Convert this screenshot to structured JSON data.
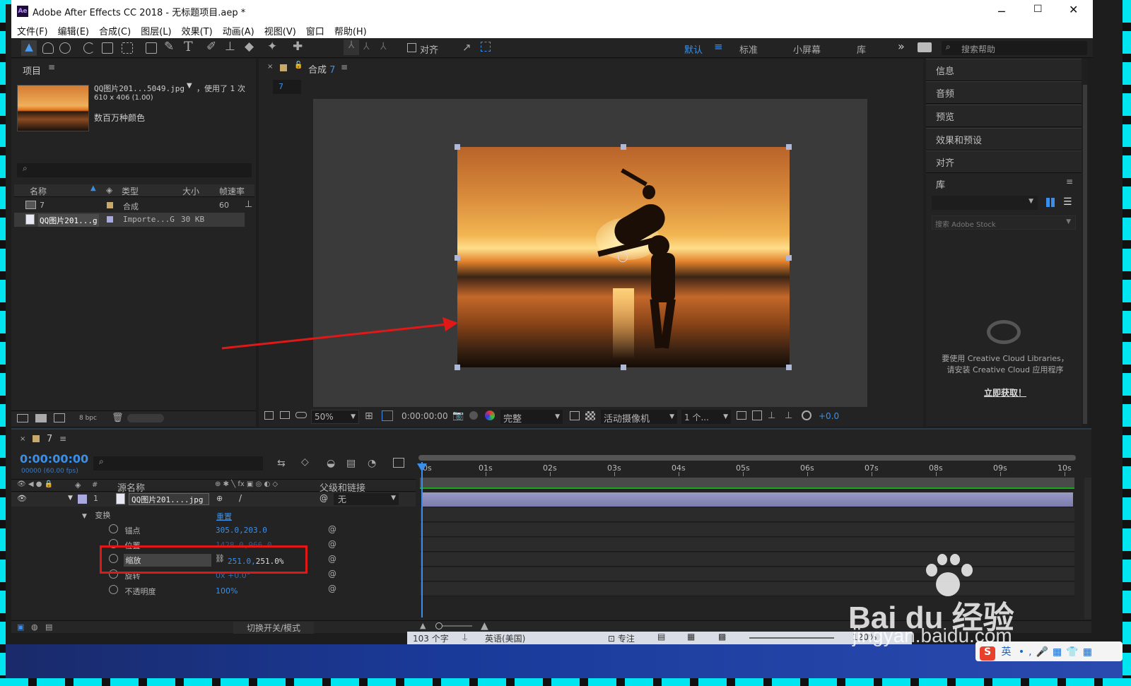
{
  "window": {
    "title": "Adobe After Effects CC 2018 - 无标题项目.aep *",
    "app_icon": "Ae"
  },
  "menu": [
    "文件(F)",
    "编辑(E)",
    "合成(C)",
    "图层(L)",
    "效果(T)",
    "动画(A)",
    "视图(V)",
    "窗口",
    "帮助(H)"
  ],
  "toolbar": {
    "align_label": "对齐",
    "workspaces": [
      "默认",
      "标准",
      "小屏幕",
      "库"
    ],
    "search_placeholder": "搜索帮助"
  },
  "project": {
    "title": "项目",
    "thumb_name": "QQ图片201...5049.jpg",
    "thumb_used": "，使用了 1 次",
    "thumb_dims": "610 x 406 (1.00)",
    "thumb_colors": "数百万种颜色",
    "columns": [
      "名称",
      "类型",
      "大小",
      "帧速率"
    ],
    "rows": [
      {
        "name": "7",
        "type": "合成",
        "size": "",
        "fps": "60"
      },
      {
        "name": "QQ图片201...g",
        "type": "Importe...G",
        "size": "30 KB",
        "fps": ""
      }
    ],
    "bpc": "8 bpc"
  },
  "comp": {
    "tab": "合成",
    "tab_num": "7",
    "flow": "7",
    "zoom": "50%",
    "timecode": "0:00:00:00",
    "resolution": "完整",
    "camera": "活动摄像机",
    "views": "1 个...",
    "exposure": "+0.0"
  },
  "right_panel": {
    "items": [
      "信息",
      "音频",
      "预览",
      "效果和预设",
      "对齐"
    ],
    "library": "库",
    "stock_placeholder": "搜索 Adobe Stock",
    "cc_msg1": "要使用 Creative Cloud Libraries，",
    "cc_msg2": "请安装 Creative Cloud 应用程序",
    "cc_link": "立即获取！"
  },
  "timeline": {
    "tab": "7",
    "timecode": "0:00:00:00",
    "fps_note": "00000 (60.00 fps)",
    "col_source": "源名称",
    "col_parent": "父级和链接",
    "layer": {
      "num": "1",
      "name": "QQ图片201....jpg",
      "parent": "无"
    },
    "transform": "变换",
    "reset": "重置",
    "props": [
      {
        "name": "锚点",
        "value": "305.0,203.0"
      },
      {
        "name": "位置",
        "value": "1428.0,966.0"
      },
      {
        "name": "缩放",
        "value": "251.0,",
        "value2": "251.0%"
      },
      {
        "name": "旋转",
        "value": "0x +0.0°"
      },
      {
        "name": "不透明度",
        "value": "100%"
      }
    ],
    "ruler": [
      "0s",
      "01s",
      "02s",
      "03s",
      "04s",
      "05s",
      "06s",
      "07s",
      "08s",
      "09s",
      "10s"
    ],
    "footer": "切换开关/模式"
  },
  "taskbar": {
    "chars": "103 个字",
    "lang": "英语(美国)",
    "focus": "专注",
    "zoom": "120%",
    "ime": "英"
  },
  "watermark": {
    "line1": "Bai du 经验",
    "line2": "jingyan.baidu.com"
  }
}
